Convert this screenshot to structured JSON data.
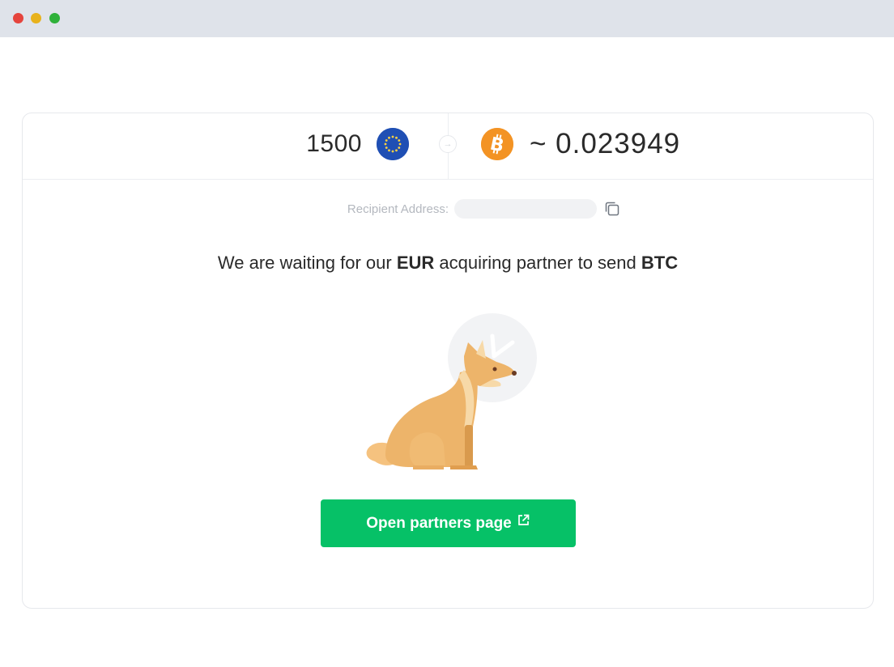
{
  "window": {
    "controls": [
      "close",
      "minimize",
      "maximize"
    ]
  },
  "conversion": {
    "from_amount": "1500",
    "from_currency_icon": "eu-flag-coin-icon",
    "arrow_icon": "arrow-right-icon",
    "to_currency_icon": "bitcoin-coin-icon",
    "to_amount": "~ 0.023949"
  },
  "recipient": {
    "label": "Recipient Address:",
    "value": "",
    "copy_icon": "copy-icon"
  },
  "status": {
    "prefix": "We are waiting for our ",
    "fiat_currency": "EUR",
    "middle": " acquiring partner to send ",
    "crypto_currency": "BTC"
  },
  "illustration": {
    "icon": "waiting-dog-illustration"
  },
  "action": {
    "button_label": "Open partners page",
    "button_icon": "external-link-icon"
  },
  "colors": {
    "accent": "#06c167",
    "eur": "#1f4fb4",
    "btc": "#f39324",
    "titlebar": "#dfe3ea"
  }
}
